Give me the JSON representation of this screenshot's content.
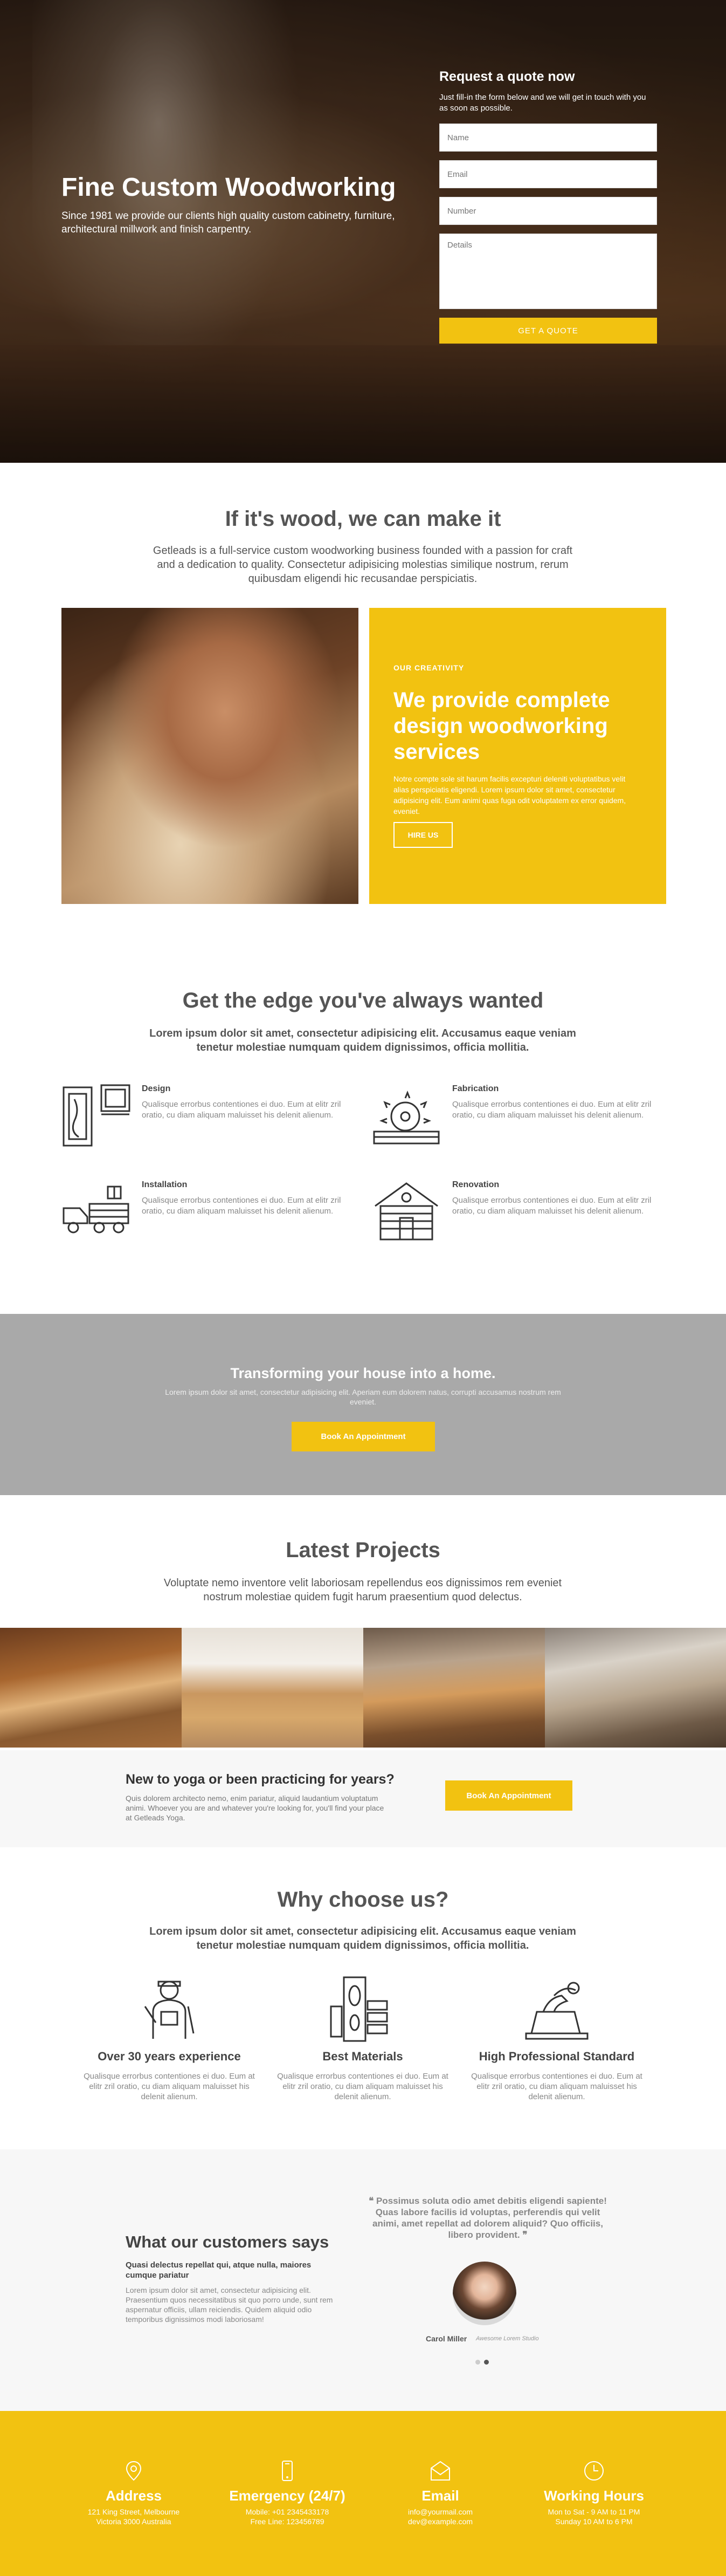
{
  "colors": {
    "accent": "#f2c211",
    "gray_band": "#a9a9a9",
    "light_band": "#f7f7f7",
    "heading": "#555555"
  },
  "hero": {
    "title": "Fine Custom Woodworking",
    "subtitle": "Since 1981 we provide our clients high quality custom cabinetry, furniture, architectural millwork and finish carpentry."
  },
  "quote_form": {
    "title": "Request a quote now",
    "text": "Just fill-in the form below and we will get in touch with you as soon as possible.",
    "name_placeholder": "Name",
    "email_placeholder": "Email",
    "number_placeholder": "Number",
    "details_placeholder": "Details",
    "submit_label": "GET A QUOTE"
  },
  "about": {
    "title": "If it's wood, we can make it",
    "subtitle": "Getleads is a full-service custom woodworking business founded with a passion for craft and a dedication to quality. Consectetur adipisicing molestias similique nostrum, rerum quibusdam eligendi hic recusandae perspiciatis.",
    "label": "OUR CREATIVITY",
    "heading": "We provide complete design woodworking services",
    "text": "Notre compte sole sit harum facilis excepturi deleniti voluptatibus velit alias perspiciatis eligendi. Lorem ipsum dolor sit amet, consectetur adipisicing elit. Eum animi quas fuga odit voluptatem ex error quidem, eveniet.",
    "button": "HIRE US"
  },
  "edge": {
    "title": "Get the edge you've always wanted",
    "subtitle": "Lorem ipsum dolor sit amet, consectetur adipisicing elit. Accusamus eaque veniam tenetur molestiae numquam quidem dignissimos, officia mollitia.",
    "features": [
      {
        "title": "Design",
        "text": "Qualisque errorbus contentiones ei duo. Eum at elitr zril oratio, cu diam aliquam maluisset his delenit alienum.",
        "icon": "design-icon"
      },
      {
        "title": "Fabrication",
        "text": "Qualisque errorbus contentiones ei duo. Eum at elitr zril oratio, cu diam aliquam maluisset his delenit alienum.",
        "icon": "saw-icon"
      },
      {
        "title": "Installation",
        "text": "Qualisque errorbus contentiones ei duo. Eum at elitr zril oratio, cu diam aliquam maluisset his delenit alienum.",
        "icon": "truck-icon"
      },
      {
        "title": "Renovation",
        "text": "Qualisque errorbus contentiones ei duo. Eum at elitr zril oratio, cu diam aliquam maluisset his delenit alienum.",
        "icon": "log-house-icon"
      }
    ]
  },
  "cta": {
    "title": "Transforming your house into a home.",
    "text": "Lorem ipsum dolor sit amet, consectetur adipisicing elit. Aperiam eum dolorem natus, corrupti accusamus nostrum rem eveniet.",
    "button": "Book An Appointment"
  },
  "projects": {
    "title": "Latest Projects",
    "subtitle": "Voluptate nemo inventore velit laboriosam repellendus eos dignissimos rem eveniet nostrum molestiae quidem fugit harum praesentium quod delectus."
  },
  "yoga": {
    "title": "New to yoga or been practicing for years?",
    "text": "Quis dolorem architecto nemo, enim pariatur, aliquid laudantium voluptatum animi. Whoever you are and whatever you're looking for, you'll find your place at Getleads Yoga.",
    "button": "Book An Appointment"
  },
  "why": {
    "title": "Why choose us?",
    "subtitle": "Lorem ipsum dolor sit amet, consectetur adipisicing elit. Accusamus eaque veniam tenetur molestiae numquam quidem dignissimos, officia mollitia.",
    "items": [
      {
        "title": "Over 30 years experience",
        "text": "Qualisque errorbus contentiones ei duo. Eum at elitr zril oratio, cu diam aliquam maluisset his delenit alienum.",
        "icon": "carpenter-icon"
      },
      {
        "title": "Best Materials",
        "text": "Qualisque errorbus contentiones ei duo. Eum at elitr zril oratio, cu diam aliquam maluisset his delenit alienum.",
        "icon": "wood-planks-icon"
      },
      {
        "title": "High Professional Standard",
        "text": "Qualisque errorbus contentiones ei duo. Eum at elitr zril oratio, cu diam aliquam maluisset his delenit alienum.",
        "icon": "plane-tool-icon"
      }
    ]
  },
  "testimonials": {
    "title": "What our customers says",
    "subtitle": "Quasi delectus repellat qui, atque nulla, maiores cumque pariatur",
    "text": "Lorem ipsum dolor sit amet, consectetur adipisicing elit. Praesentium quos necessitatibus sit quo porro unde, sunt rem aspernatur officiis, ullam reiciendis. Quidem aliquid odio temporibus dignissimos modi laboriosam!",
    "quote": "Possimus soluta odio amet debitis eligendi sapiente! Quas labore facilis id voluptas, perferendis qui velit animi, amet repellat ad dolorem aliquid? Quo officiis, libero provident.",
    "name": "Carol Miller",
    "role": "Awesome Lorem Studio",
    "active_slide": 2,
    "slide_count": 2
  },
  "footer": {
    "address": {
      "title": "Address",
      "line1": "121 King Street, Melbourne",
      "line2": "Victoria 3000 Australia",
      "icon": "location-pin-icon"
    },
    "emergency": {
      "title": "Emergency (24/7)",
      "line1": "Mobile: +01 2345433178",
      "line2": "Free Line: 123456789",
      "icon": "mobile-icon"
    },
    "email": {
      "title": "Email",
      "line1": "info@yourmail.com",
      "line2": "dev@example.com",
      "icon": "envelope-icon"
    },
    "hours": {
      "title": "Working Hours",
      "line1": "Mon to Sat - 9 AM to 11 PM",
      "line2": "Sunday 10 AM to 6 PM",
      "icon": "clock-icon"
    }
  }
}
